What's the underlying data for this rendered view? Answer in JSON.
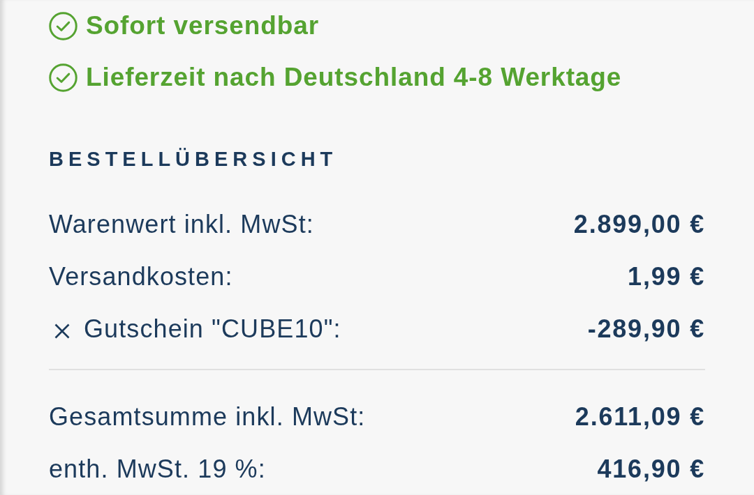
{
  "availability": [
    "Sofort versendbar",
    "Lieferzeit nach Deutschland 4-8 Werktage"
  ],
  "order_summary": {
    "title": "BESTELLÜBERSICHT",
    "rows": [
      {
        "kind": "line",
        "label": "Warenwert inkl. MwSt:",
        "value": "2.899,00 €"
      },
      {
        "kind": "line",
        "label": "Versandkosten:",
        "value": "1,99 €"
      },
      {
        "kind": "coupon",
        "label": "Gutschein \"CUBE10\":",
        "value": "-289,90 €"
      }
    ],
    "totals": [
      {
        "label": "Gesamtsumme inkl. MwSt:",
        "value": "2.611,09 €"
      },
      {
        "label": "enth. MwSt. 19 %:",
        "value": "416,90 €"
      }
    ]
  }
}
